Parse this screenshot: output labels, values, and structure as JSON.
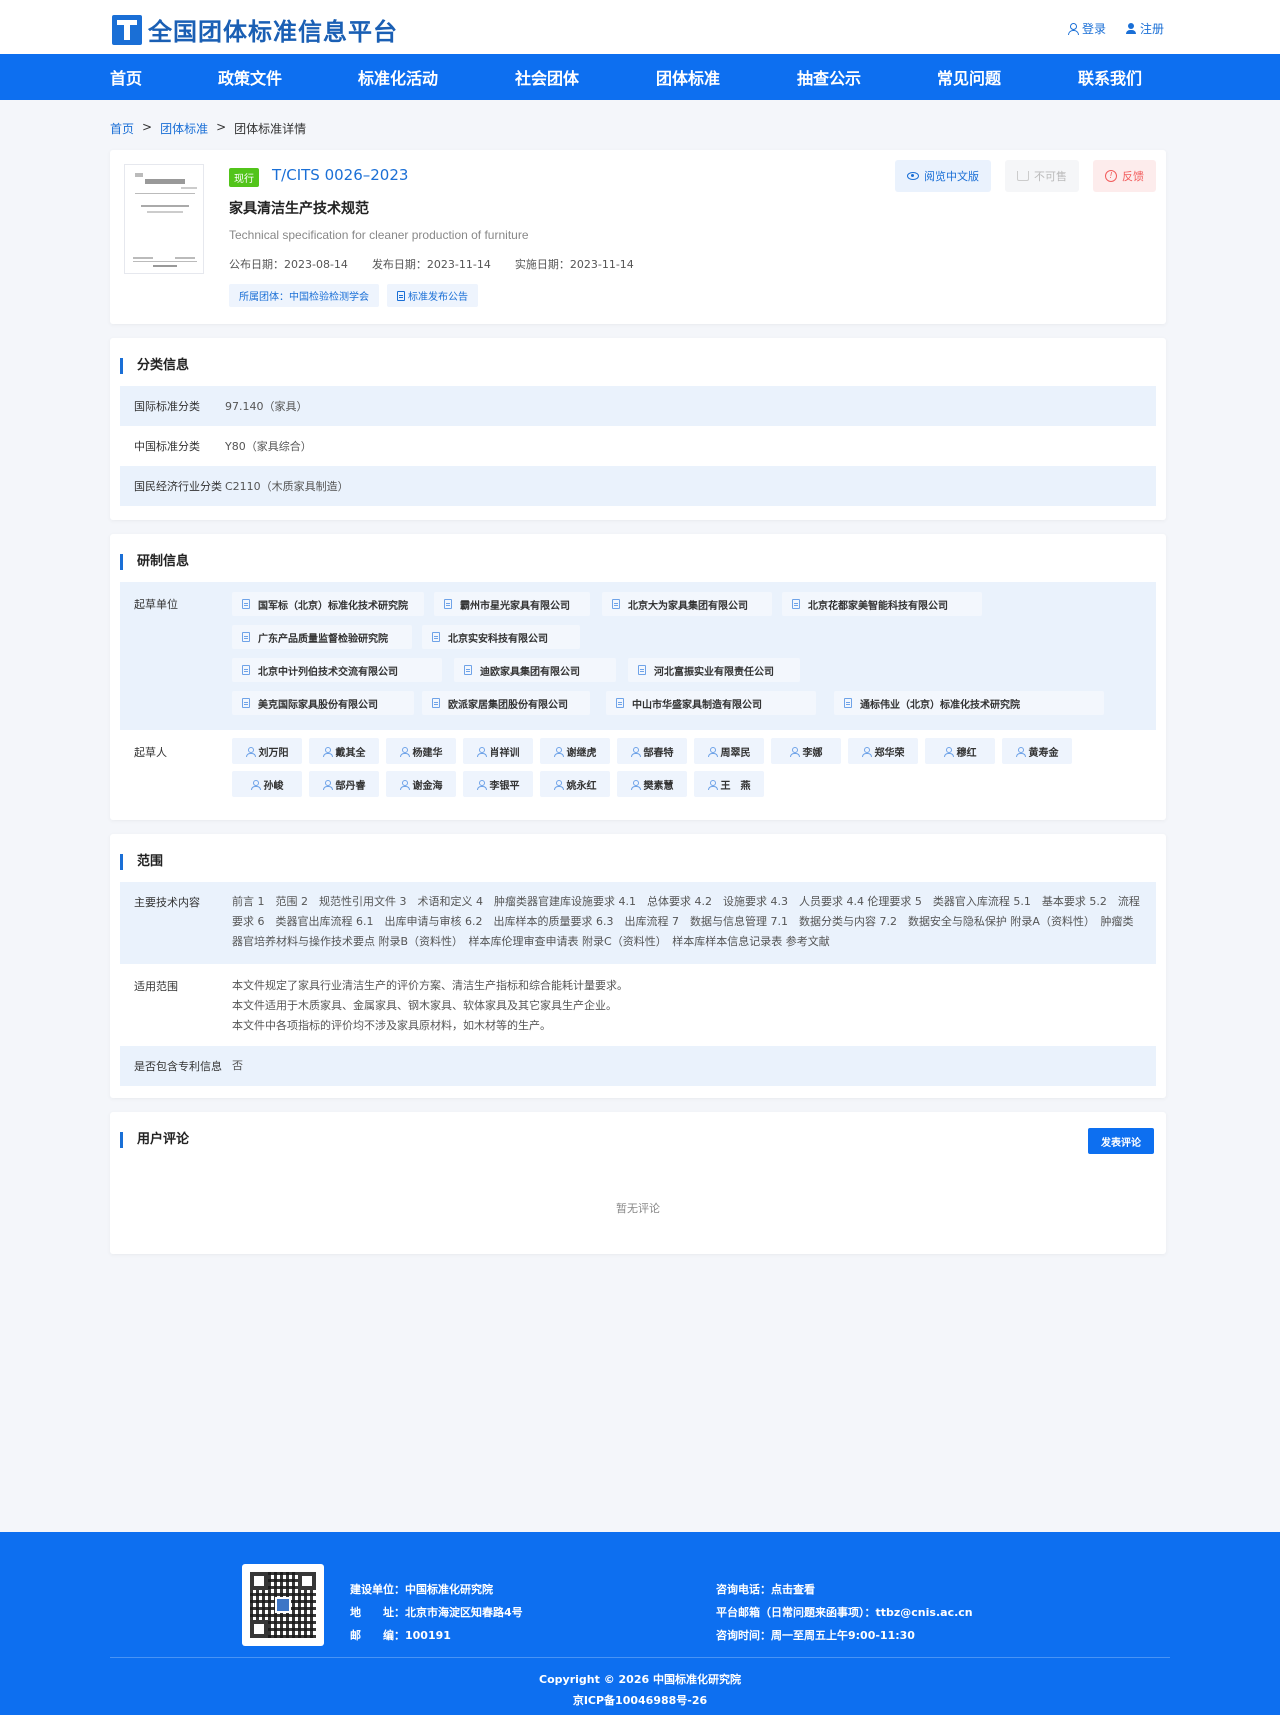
{
  "header": {
    "logo_text": "全国团体标准信息平台",
    "login": "登录",
    "register": "注册"
  },
  "nav": [
    "首页",
    "政策文件",
    "标准化活动",
    "社会团体",
    "团体标准",
    "抽查公示",
    "常见问题",
    "联系我们"
  ],
  "breadcrumb": {
    "home": "首页",
    "sep1": ">",
    "category": "团体标准",
    "sep2": ">",
    "current": "团体标准详情"
  },
  "standard": {
    "status": "现行",
    "code": "T/CITS 0026–2023",
    "title": "家具清洁生产技术规范",
    "title_en": "Technical specification for cleaner production of furniture",
    "dates": [
      "公布日期：2023-08-14",
      "发布日期：2023-11-14",
      "实施日期：2023-11-14"
    ],
    "org_tag": "所属团体：中国检验检测学会",
    "notice_tag": "标准发布公告",
    "actions": {
      "preview": "阅览中文版",
      "buy": "不可售",
      "feedback": "反馈"
    }
  },
  "classification": {
    "title": "分类信息",
    "rows": [
      {
        "label": "国际标准分类",
        "value": "97.140（家具）"
      },
      {
        "label": "中国标准分类",
        "value": "Y80（家具综合）"
      },
      {
        "label": "国民经济行业分类",
        "value": "C2110（木质家具制造）"
      }
    ]
  },
  "development": {
    "title": "研制信息",
    "drafting_units_label": "起草单位",
    "drafting_units": [
      "国军标（北京）标准化技术研究院",
      "霸州市星光家具有限公司",
      "北京大为家具集团有限公司",
      "北京花都家美智能科技有限公司",
      "广东产品质量监督检验研究院",
      "北京实安科技有限公司",
      "北京中计列伯技术交流有限公司",
      "迪欧家具集团有限公司",
      "河北富振实业有限责任公司",
      "美克国际家具股份有限公司",
      "欧派家居集团股份有限公司",
      "中山市华盛家具制造有限公司",
      "通标伟业（北京）标准化技术研究院"
    ],
    "drafters_label": "起草人",
    "drafters": [
      "刘万阳",
      "戴其全",
      "杨建华",
      "肖祥训",
      "谢继虎",
      "郜春特",
      "周翠民",
      "李娜",
      "郑华荣",
      "穆红",
      "黄寿金",
      "孙峻",
      "郜丹睿",
      "谢金海",
      "李银平",
      "姚永红",
      "樊素慧",
      "王　燕"
    ]
  },
  "scope": {
    "title": "范围",
    "main_content_label": "主要技术内容",
    "main_content": "前言 1　范围 2　规范性引用文件 3　术语和定义 4　肿瘤类器官建库设施要求 4.1　总体要求 4.2　设施要求 4.3　人员要求 4.4 伦理要求 5　类器官入库流程 5.1　基本要求 5.2　流程要求 6　类器官出库流程 6.1　出库申请与审核 6.2　出库样本的质量要求 6.3　出库流程 7　数据与信息管理 7.1　数据分类与内容 7.2　数据安全与隐私保护 附录A（资料性）　肿瘤类器官培养材料与操作技术要点 附录B（资料性）　样本库伦理审查申请表 附录C（资料性）　样本库样本信息记录表 参考文献",
    "applicable_label": "适用范围",
    "applicable": [
      "本文件规定了家具行业清洁生产的评价方案、清洁生产指标和综合能耗计量要求。",
      "本文件适用于木质家具、金属家具、钢木家具、软体家具及其它家具生产企业。",
      "本文件中各项指标的评价均不涉及家具原材料，如木材等的生产。"
    ],
    "patent_label": "是否包含专利信息",
    "patent": "否"
  },
  "comments": {
    "title": "用户评论",
    "post_button": "发表评论",
    "empty": "暂无评论"
  },
  "footer": {
    "builder": "建设单位：中国标准化研究院",
    "address": "地　　址：北京市海淀区知春路4号",
    "postcode": "邮　　编：100191",
    "phone": "咨询电话：点击查看",
    "email": "平台邮箱（日常问题来函事项）：ttbz@cnis.ac.cn",
    "hours": "咨询时间：周一至周五上午9:00-11:30",
    "copyright": "Copyright © 2026 中国标准化研究院",
    "icp": "京ICP备10046988号-26"
  }
}
